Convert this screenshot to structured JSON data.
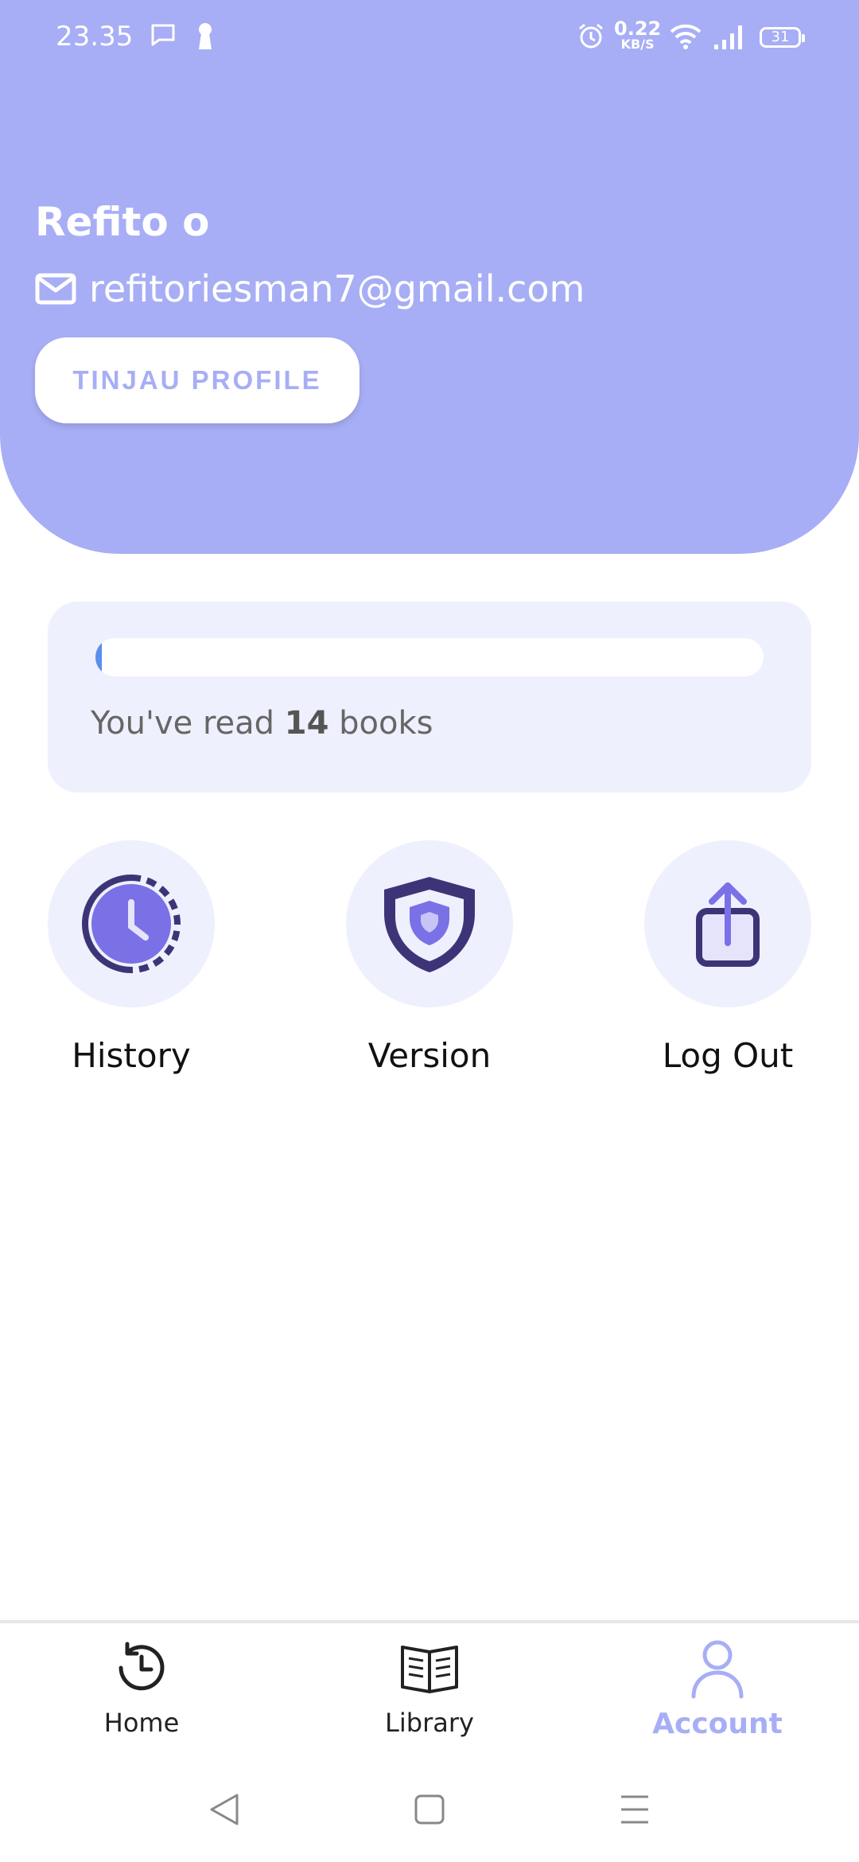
{
  "status_bar": {
    "time": "23.35",
    "net_speed_value": "0.22",
    "net_speed_unit": "KB/S",
    "battery": "31"
  },
  "profile": {
    "name": "Refito o",
    "email": "refitoriesman7@gmail.com",
    "review_button_label": "TINJAU PROFILE"
  },
  "reading": {
    "prefix": "You've read ",
    "count": "14",
    "suffix": " books",
    "progress_fraction": 0.01
  },
  "actions": [
    {
      "label": "History",
      "icon": "history-clock-icon"
    },
    {
      "label": "Version",
      "icon": "shield-icon"
    },
    {
      "label": "Log Out",
      "icon": "share-upload-icon"
    }
  ],
  "bottom_nav": {
    "items": [
      {
        "label": "Home",
        "icon": "history-icon"
      },
      {
        "label": "Library",
        "icon": "book-icon"
      },
      {
        "label": "Account",
        "icon": "user-icon",
        "active": true
      }
    ]
  },
  "colors": {
    "accent": "#a7aef5",
    "card_bg": "#eef0fd",
    "icon_dark": "#3d3478",
    "icon_mid": "#7b71e6",
    "progress": "#5a8ef0"
  }
}
